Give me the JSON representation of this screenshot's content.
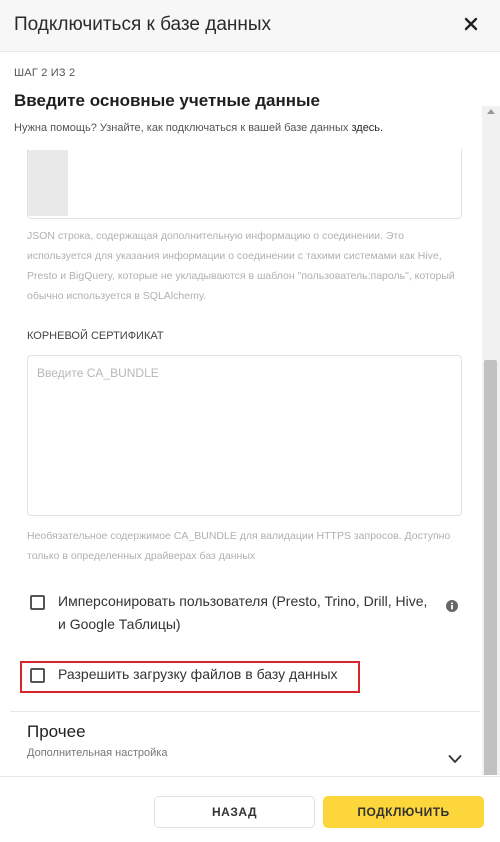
{
  "header": {
    "title": "Подключиться к базе данных"
  },
  "step": {
    "label": "ШАГ 2 ИЗ 2"
  },
  "form": {
    "heading": "Введите основные учетные данные",
    "help_text": "Нужна помощь? Узнайте, как подключаться к вашей базе данных",
    "help_link": "здесь."
  },
  "extra_json": {
    "hint": "JSON строка, содержащая дополнительную информацию о соединении. Это используется для указания информации о соединении с тахими системами как Hive, Presto и BigQuery, которые не укладываются в шаблон \"пользователь:пароль\", который обычно используется в SQLAlchemy."
  },
  "certificate": {
    "label": "КОРНЕВОЙ СЕРТИФИКАТ",
    "placeholder": "Введите CA_BUNDLE",
    "hint": "Необязательное содержимое CA_BUNDLE для валидации HTTPS запросов. Доступно только в определенных драйверах баз данных"
  },
  "options": {
    "impersonate_label": "Имперсонировать пользователя (Presto, Trino, Drill, Hive, и Google Таблицы)",
    "upload_label": "Разрешить загрузку файлов в базу данных",
    "impersonate_checked": false,
    "upload_checked": false
  },
  "other": {
    "title": "Прочее",
    "subtitle": "Дополнительная настройка"
  },
  "footer": {
    "back_label": "НАЗАД",
    "connect_label": "ПОДКЛЮЧИТЬ"
  },
  "colors": {
    "accent": "#fcd63a",
    "highlight": "#d7262b"
  },
  "icons": {
    "close": "close-icon",
    "info": "info-icon",
    "chevron": "chevron-down-icon"
  }
}
